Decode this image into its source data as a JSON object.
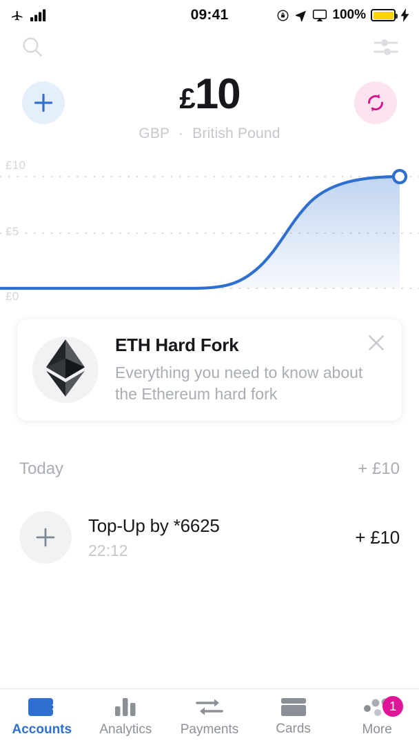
{
  "status_bar": {
    "airplane_icon": "airplane-icon",
    "signal_icon": "signal-bars-icon",
    "time": "09:41",
    "lock_rotation_icon": "rotation-lock-icon",
    "location_icon": "location-arrow-icon",
    "airplay_icon": "airplay-icon",
    "battery_percent": "100%",
    "charging_icon": "lightning-bolt-icon"
  },
  "toolbar": {
    "search_icon": "search-icon",
    "filter_icon": "sliders-filter-icon"
  },
  "balance": {
    "add_icon": "plus-icon",
    "exchange_icon": "exchange-circular-arrows-icon",
    "currency_symbol": "£",
    "amount": "10",
    "currency_code": "GBP",
    "separator": "·",
    "currency_name": "British Pound"
  },
  "chart_data": {
    "type": "area",
    "title": "",
    "xlabel": "",
    "ylabel": "",
    "ylim": [
      0,
      10
    ],
    "ytick_labels": [
      "£10",
      "£5",
      "£0"
    ],
    "ytick_values": [
      10,
      5,
      0
    ],
    "grid": true,
    "legend": "none",
    "line_color": "#2f6fd0",
    "fill_color": "#2f6fd0",
    "marker": {
      "x": 1.0,
      "y": 10,
      "style": "hollow-circle"
    },
    "series": [
      {
        "name": "Balance",
        "x": [
          0.0,
          0.1,
          0.2,
          0.3,
          0.4,
          0.45,
          0.5,
          0.55,
          0.6,
          0.65,
          0.7,
          0.75,
          0.8,
          0.85,
          0.9,
          0.95,
          1.0
        ],
        "values": [
          0,
          0,
          0,
          0,
          0,
          0.1,
          0.4,
          1.0,
          2.1,
          3.6,
          5.3,
          6.9,
          8.2,
          9.1,
          9.7,
          9.95,
          10
        ]
      }
    ]
  },
  "promo": {
    "logo_icon": "ethereum-logo-icon",
    "title": "ETH Hard Fork",
    "description": "Everything you need to know about the Ethereum hard fork",
    "close_icon": "close-icon"
  },
  "transactions": {
    "group_label": "Today",
    "group_total": "+ £10",
    "items": [
      {
        "icon": "plus-icon",
        "title": "Top-Up by *6625",
        "time": "22:12",
        "amount": "+ £10"
      }
    ]
  },
  "tabbar": {
    "items": [
      {
        "label": "Accounts",
        "icon": "wallet-icon",
        "active": true
      },
      {
        "label": "Analytics",
        "icon": "bar-chart-icon",
        "active": false
      },
      {
        "label": "Payments",
        "icon": "transfer-arrows-icon",
        "active": false
      },
      {
        "label": "Cards",
        "icon": "credit-card-icon",
        "active": false
      },
      {
        "label": "More",
        "icon": "more-dots-icon",
        "active": false,
        "badge": "1"
      }
    ]
  },
  "colors": {
    "accent_blue": "#2f6fd0",
    "accent_pink": "#e0169a",
    "text_dark": "#16181c",
    "text_muted": "#a9adb4",
    "battery_yellow": "#fcd303"
  }
}
